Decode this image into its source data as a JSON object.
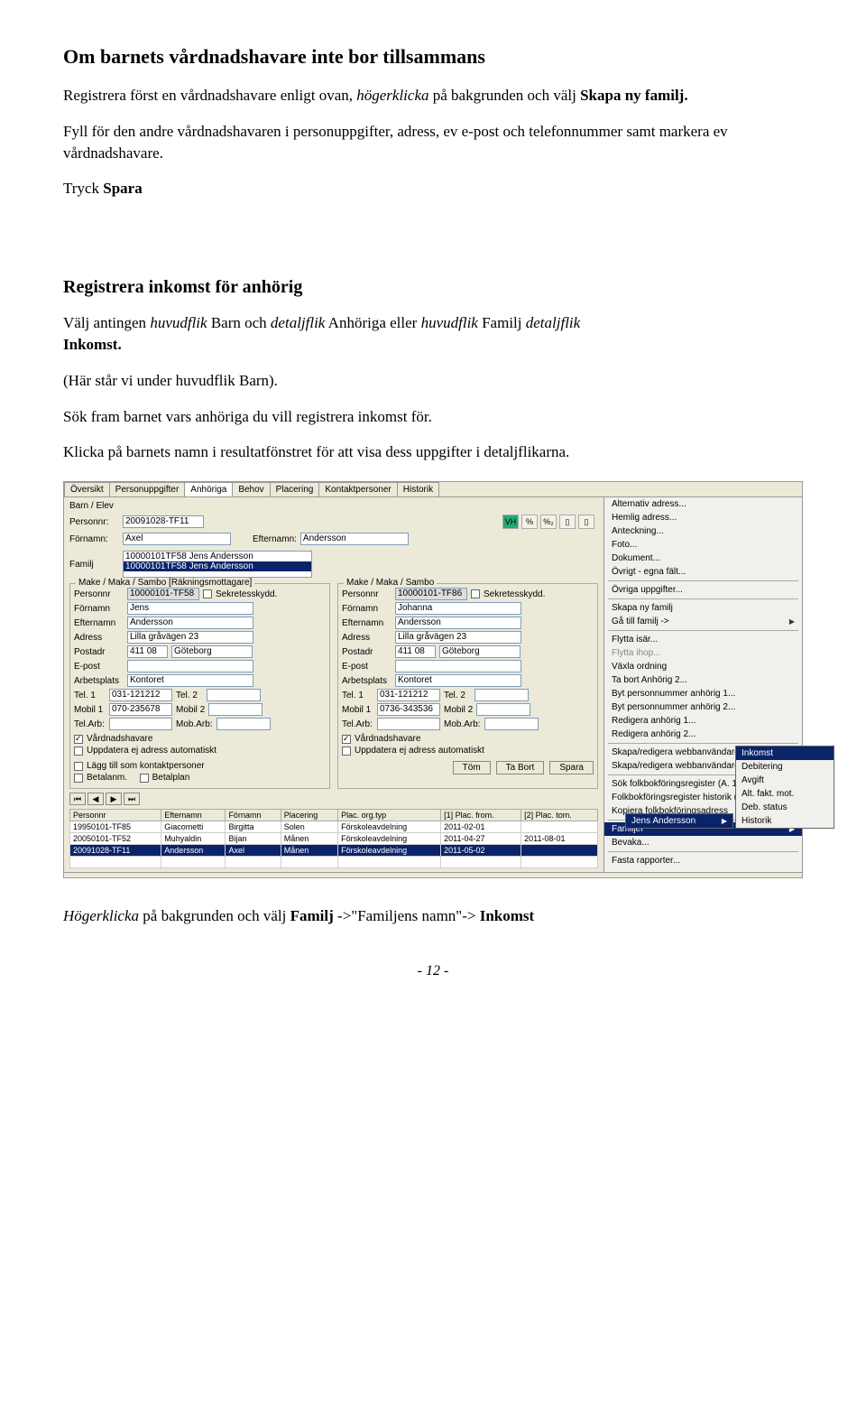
{
  "doc": {
    "h1": "Om barnets vårdnadshavare inte bor tillsammans",
    "p1a": "Registrera först en vårdnadshavare enligt ovan, ",
    "p1b": "högerklicka",
    "p1c": " på bakgrunden och välj ",
    "p1d": "Skapa ny familj.",
    "p2": "Fyll för den andre vårdnadshavaren i personuppgifter, adress, ev e-post och telefonnummer samt markera ev vårdnadshavare.",
    "p3a": "Tryck ",
    "p3b": "Spara",
    "h2": "Registrera inkomst för anhörig",
    "p4a": "Välj antingen ",
    "p4b": "huvudflik",
    "p4c": " Barn och ",
    "p4d": "detaljflik",
    "p4e": " Anhöriga eller ",
    "p4f": "huvudflik",
    "p4g": " Familj ",
    "p4h": "detaljflik",
    "p4i": " Inkomst.",
    "p5": "(Här står vi under huvudflik Barn).",
    "p6": "Sök fram barnet vars anhöriga du vill registrera inkomst för.",
    "p7": "Klicka på barnets namn i resultatfönstret för att visa dess uppgifter i detaljflikarna.",
    "p8a": "Högerklicka",
    "p8b": " på bakgrunden och välj ",
    "p8c": "Familj",
    "p8d": " ->\"Familjens namn\"-> ",
    "p8e": "Inkomst",
    "footer": "- 12 -"
  },
  "app": {
    "tabs": [
      "Översikt",
      "Personuppgifter",
      "Anhöriga",
      "Behov",
      "Placering",
      "Kontaktpersoner",
      "Historik"
    ],
    "activeTab": 2,
    "section1": "Barn / Elev",
    "personnr_lbl": "Personnr:",
    "personnr_val": "20091028-TF11",
    "fornamn_lbl": "Förnamn:",
    "fornamn_val": "Axel",
    "efternamn_lbl": "Efternamn:",
    "efternamn_val": "Andersson",
    "vhbadge": "VH",
    "familj_lbl": "Familj",
    "familj_opt1": "10000101TF58 Jens Andersson",
    "familj_opt2": "10000101TF58 Jens Andersson",
    "panel1_title": "Make / Maka / Sambo [Räkningsmottagare]",
    "panel2_title": "Make / Maka / Sambo",
    "lbls": {
      "personnr": "Personnr",
      "sekret": "Sekretesskydd.",
      "fornamn": "Förnamn",
      "efternamn": "Efternamn",
      "adress": "Adress",
      "postadr": "Postadr",
      "epost": "E-post",
      "arbetsplats": "Arbetsplats",
      "tel1": "Tel. 1",
      "tel2": "Tel. 2",
      "mobil1": "Mobil 1",
      "mobil2": "Mobil 2",
      "telarb": "Tel.Arb:",
      "mobarb": "Mob.Arb:",
      "vardnads": "Vårdnadshavare",
      "uppd": "Uppdatera ej adress automatiskt",
      "lagg": "Lägg till som kontaktpersoner",
      "betalanm": "Betalanm.",
      "betalplan": "Betalplan"
    },
    "p1": {
      "personnr": "10000101-TF58",
      "fornamn": "Jens",
      "efternamn": "Andersson",
      "adress": "Lilla gråvägen 23",
      "post1": "411 08",
      "post2": "Göteborg",
      "arbets": "Kontoret",
      "tel1": "031-121212",
      "mobil1": "070-235678"
    },
    "p2": {
      "personnr": "10000101-TF86",
      "fornamn": "Johanna",
      "efternamn": "Andersson",
      "adress": "Lilla gråvägen 23",
      "post1": "411 08",
      "post2": "Göteborg",
      "arbets": "Kontoret",
      "tel1": "031-121212",
      "mobil1": "0736-343536"
    },
    "btn_tom": "Töm",
    "btn_tabort": "Ta Bort",
    "btn_spara": "Spara",
    "menu": {
      "alt": "Alternativ adress...",
      "hemlig": "Hemlig adress...",
      "anteck": "Anteckning...",
      "foto": "Foto...",
      "dokument": "Dokument...",
      "ovrigt": "Övrigt - egna fält...",
      "ovriga": "Övriga uppgifter...",
      "skapa": "Skapa ny familj",
      "gatill": "Gå till familj ->",
      "flytta": "Flytta isär...",
      "flyttaihop": "Flytta ihop...",
      "vaxla": "Växla ordning",
      "tabort": "Ta bort Anhörig 2...",
      "byt1": "Byt personnummer anhörig 1...",
      "byt2": "Byt personnummer anhörig 2...",
      "red1": "Redigera anhörig 1...",
      "red2": "Redigera anhörig 2...",
      "webb1": "Skapa/redigera webbanvändare anhörig 1...",
      "webb2": "Skapa/redigera webbanvändare anhörig 2...",
      "sok1": "Sök folkbokföringsregister (A. 1)...",
      "sok2": "Folkbokföringsregister historik (A. 1)...",
      "kopiera": "Kopiera folkbokföringsadress",
      "familjer": "Familjer",
      "bevaka": "Bevaka...",
      "fasta": "Fasta rapporter..."
    },
    "submenu1": {
      "item": "Jens Andersson"
    },
    "submenu2": {
      "i1": "Inkomst",
      "i2": "Debitering",
      "i3": "Avgift",
      "i4": "Alt. fakt. mot.",
      "i5": "Deb. status",
      "i6": "Historik"
    },
    "grid": {
      "h": [
        "Personnr",
        "Efternamn",
        "Förnamn",
        "Placering",
        "Plac. org.typ",
        "[1] Plac. from.",
        "[2] Plac. tom."
      ],
      "r1": [
        "19950101-TF85",
        "Giacometti",
        "Birgitta",
        "Solen",
        "Förskoleavdelning",
        "2011-02-01",
        ""
      ],
      "r2": [
        "20050101-TF52",
        "Muhyaldin",
        "Bijan",
        "Månen",
        "Förskoleavdelning",
        "2011-04-27",
        "2011-08-01"
      ],
      "r3": [
        "20091028-TF11",
        "Andersson",
        "Axel",
        "Månen",
        "Förskoleavdelning",
        "2011-05-02",
        ""
      ]
    }
  }
}
